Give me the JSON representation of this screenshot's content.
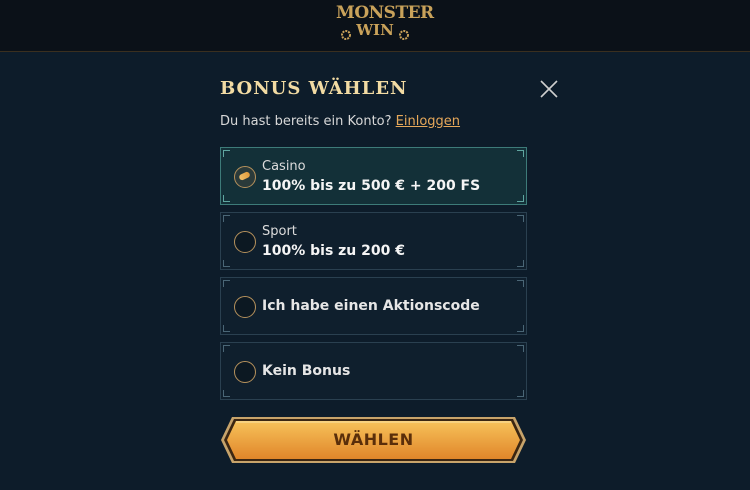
{
  "header": {
    "logo_line1": "MONSTER",
    "logo_line2": "WIN"
  },
  "modal": {
    "title": "BONUS WÄHLEN",
    "subtitle": "Du hast bereits ein Konto?",
    "login_link": "Einloggen"
  },
  "options": [
    {
      "label": "Casino",
      "value": "100% bis zu 500 € + 200 FS",
      "selected": true
    },
    {
      "label": "Sport",
      "value": "100% bis zu 200 €",
      "selected": false
    },
    {
      "label": "Ich habe einen Aktionscode",
      "selected": false
    },
    {
      "label": "Kein Bonus",
      "selected": false
    }
  ],
  "submit_label": "WÄHLEN",
  "colors": {
    "accent": "#e6a85a",
    "button_top": "#f7c25a",
    "button_bottom": "#e0862a",
    "background": "#0d1c2a"
  }
}
